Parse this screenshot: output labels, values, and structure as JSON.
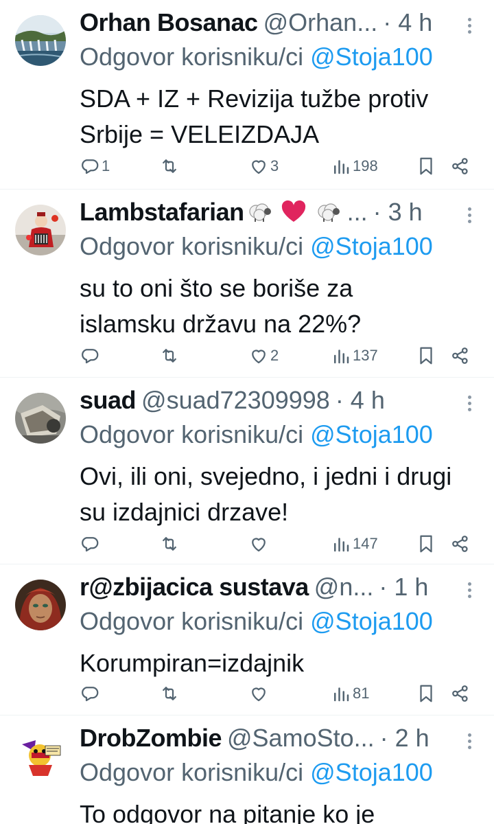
{
  "tweets": [
    {
      "name": "Orhan Bosanac",
      "handle": "@Orhan...",
      "time": "· 4 h",
      "reply_prefix": "Odgovor korisniku/ci ",
      "reply_mention": "@Stoja100",
      "text": "SDA + IZ + Revizija tužbe protiv\nSrbije = VELEIZDAJA",
      "replies": "1",
      "retweets": "",
      "likes": "3",
      "views": "198",
      "avatar": "waterfall-landscape"
    },
    {
      "name": "Lambstafarian",
      "handle": "...",
      "time": "· 3 h",
      "reply_prefix": "Odgovor korisniku/ci ",
      "reply_mention": "@Stoja100",
      "text": "su to oni što se boriše za\nislamsku državu na 22%?",
      "replies": "",
      "retweets": "",
      "likes": "2",
      "views": "137",
      "avatar": "accordion-player"
    },
    {
      "name": "suad",
      "handle": "@suad72309998",
      "time": "· 4 h",
      "reply_prefix": "Odgovor korisniku/ci ",
      "reply_mention": "@Stoja100",
      "text": "Ovi, ili oni, svejedno, i jedni i drugi\nsu izdajnici drzave!",
      "replies": "",
      "retweets": "",
      "likes": "",
      "views": "147",
      "avatar": "gray-photo"
    },
    {
      "name": "r@zbijacica sustava",
      "handle": "@n...",
      "time": "· 1 h",
      "reply_prefix": "Odgovor korisniku/ci ",
      "reply_mention": "@Stoja100",
      "text": "Korumpiran=izdajnik",
      "replies": "",
      "retweets": "",
      "likes": "",
      "views": "81",
      "avatar": "portrait-woman"
    },
    {
      "name": "DrobZombie",
      "handle": "@SamoSto...",
      "time": "· 2 h",
      "reply_prefix": "Odgovor korisniku/ci ",
      "reply_mention": "@Stoja100",
      "text": "To odgovor na pitanje ko je",
      "avatar": "cartoon-character"
    }
  ],
  "colors": {
    "text": "#0f1419",
    "secondary": "#536471",
    "link": "#1d9bf0",
    "divider": "#eff3f4",
    "heart": "#e0245e"
  }
}
